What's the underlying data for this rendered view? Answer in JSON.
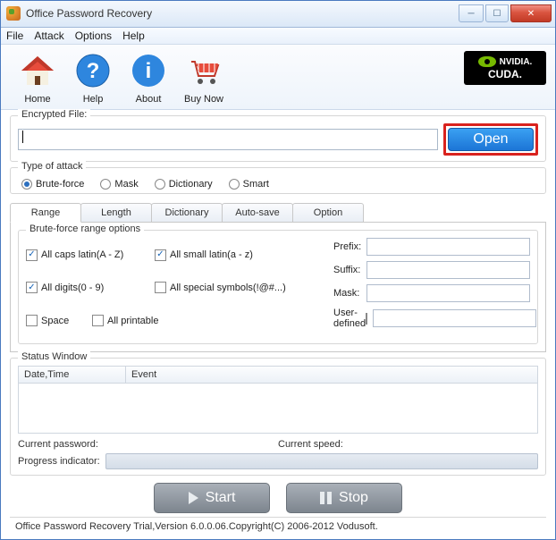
{
  "window": {
    "title": "Office Password Recovery"
  },
  "menu": {
    "file": "File",
    "attack": "Attack",
    "options": "Options",
    "help": "Help"
  },
  "toolbar": {
    "home": "Home",
    "help": "Help",
    "about": "About",
    "buynow": "Buy Now",
    "nvidia": "NVIDIA.",
    "cuda": "CUDA."
  },
  "file": {
    "legend": "Encrypted File:",
    "value": "",
    "open": "Open"
  },
  "attack": {
    "legend": "Type of attack",
    "bruteforce": "Brute-force",
    "mask": "Mask",
    "dictionary": "Dictionary",
    "smart": "Smart"
  },
  "tabs": {
    "range": "Range",
    "length": "Length",
    "dictionary": "Dictionary",
    "autosave": "Auto-save",
    "option": "Option"
  },
  "range": {
    "legend": "Brute-force range options",
    "caps": "All caps latin(A - Z)",
    "small": "All small latin(a - z)",
    "digits": "All digits(0 - 9)",
    "symbols": "All special symbols(!@#...)",
    "space": "Space",
    "printable": "All printable",
    "prefix": "Prefix:",
    "suffix": "Suffix:",
    "maskl": "Mask:",
    "userdef": "User-defined"
  },
  "status": {
    "legend": "Status Window",
    "col1": "Date,Time",
    "col2": "Event",
    "curpass": "Current password:",
    "curspeed": "Current speed:",
    "prog": "Progress indicator:"
  },
  "buttons": {
    "start": "Start",
    "stop": "Stop"
  },
  "footer": "Office Password Recovery Trial,Version 6.0.0.06.Copyright(C) 2006-2012 Vodusoft."
}
